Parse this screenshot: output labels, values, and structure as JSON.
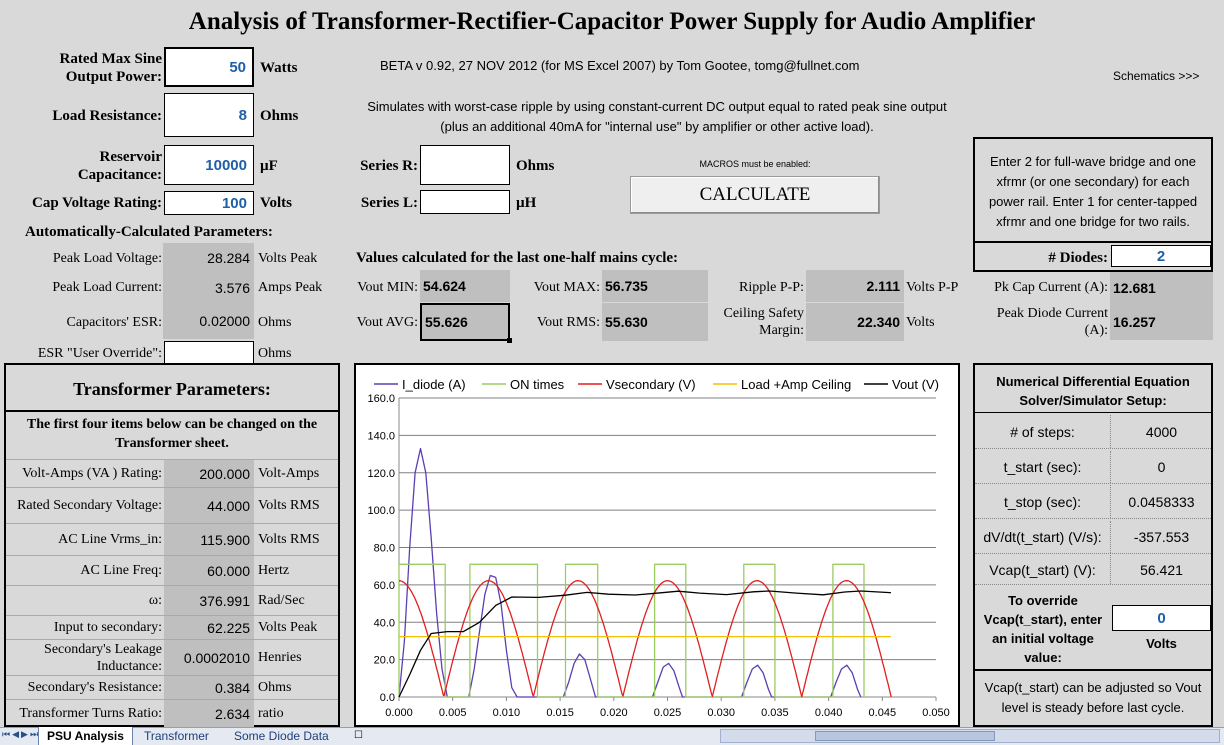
{
  "title": "Analysis of Transformer-Rectifier-Capacitor Power Supply for Audio Amplifier",
  "version_line": "BETA v 0.92, 27 NOV 2012 (for MS Excel 2007) by Tom Gootee, tomg@fullnet.com",
  "schematics_link": "Schematics >>>",
  "description_line1": "Simulates with worst-case ripple by using constant-current DC output equal to rated peak sine output",
  "description_line2": "(plus an additional 40mA for \"internal use\" by amplifier or other active load).",
  "inputs": {
    "rated_power_label": "Rated Max Sine Output Power:",
    "rated_power_value": "50",
    "rated_power_unit": "Watts",
    "load_res_label": "Load Resistance:",
    "load_res_value": "8",
    "load_res_unit": "Ohms",
    "reservoir_label": "Reservoir Capacitance:",
    "reservoir_value": "10000",
    "reservoir_unit": "µF",
    "cap_voltage_label": "Cap Voltage Rating:",
    "cap_voltage_value": "100",
    "cap_voltage_unit": "Volts",
    "series_r_label": "Series R:",
    "series_r_value": "",
    "series_r_unit": "Ohms",
    "series_l_label": "Series L:",
    "series_l_value": "",
    "series_l_unit": "µH"
  },
  "macros_note": "MACROS must be enabled:",
  "calculate_button": "CALCULATE",
  "diodes_panel": {
    "note": "Enter 2 for full-wave bridge and one xfrmr (or one secondary) for each power rail. Enter 1 for center-tapped xfrmr and one bridge for two rails.",
    "label": "# Diodes:",
    "value": "2"
  },
  "auto_params": {
    "heading": "Automatically-Calculated Parameters:",
    "peak_load_voltage_label": "Peak Load Voltage:",
    "peak_load_voltage_value": "28.284",
    "peak_load_voltage_unit": "Volts Peak",
    "peak_load_current_label": "Peak Load Current:",
    "peak_load_current_value": "3.576",
    "peak_load_current_unit": "Amps Peak",
    "esr_label": "Capacitors' ESR:",
    "esr_value": "0.02000",
    "esr_unit": "Ohms",
    "esr_override_label": "ESR \"User Override\":",
    "esr_override_value": "",
    "esr_override_unit": "Ohms"
  },
  "values": {
    "heading": "Values calculated for the last one-half mains cycle:",
    "vout_min_label": "Vout MIN:",
    "vout_min_value": "54.624",
    "vout_max_label": "Vout MAX:",
    "vout_max_value": "56.735",
    "ripple_label": "Ripple P-P:",
    "ripple_value": "2.111",
    "ripple_unit": "Volts P-P",
    "vout_avg_label": "Vout AVG:",
    "vout_avg_value": "55.626",
    "vout_rms_label": "Vout RMS:",
    "vout_rms_value": "55.630",
    "ceiling_label": "Ceiling Safety Margin:",
    "ceiling_value": "22.340",
    "ceiling_unit": "Volts",
    "pk_cap_label": "Pk Cap Current (A):",
    "pk_cap_value": "12.681",
    "peak_diode_label": "Peak Diode Current (A):",
    "peak_diode_value": "16.257"
  },
  "transformer": {
    "heading": "Transformer Parameters:",
    "subheading": "The first four items below can be changed  on the Transformer sheet.",
    "rows": [
      {
        "label": "Volt-Amps (VA ) Rating:",
        "value": "200.000",
        "unit": "Volt-Amps"
      },
      {
        "label": "Rated Secondary Voltage:",
        "value": "44.000",
        "unit": "Volts RMS"
      },
      {
        "label": "AC Line Vrms_in:",
        "value": "115.900",
        "unit": "Volts RMS"
      },
      {
        "label": "AC Line Freq:",
        "value": "60.000",
        "unit": "Hertz"
      },
      {
        "label": "ω:",
        "value": "376.991",
        "unit": "Rad/Sec"
      },
      {
        "label": "Input to secondary:",
        "value": "62.225",
        "unit": "Volts Peak"
      },
      {
        "label": "Secondary's Leakage Inductance:",
        "value": "0.0002010",
        "unit": "Henries"
      },
      {
        "label": "Secondary's Resistance:",
        "value": "0.384",
        "unit": "Ohms"
      },
      {
        "label": "Transformer Turns Ratio:",
        "value": "2.634",
        "unit": "ratio"
      }
    ]
  },
  "solver": {
    "heading": "Numerical Differential Equation Solver/Simulator Setup:",
    "rows": [
      {
        "label": "# of steps:",
        "value": "4000"
      },
      {
        "label": "t_start (sec):",
        "value": "0"
      },
      {
        "label": "t_stop (sec):",
        "value": "0.0458333"
      },
      {
        "label": "dV/dt(t_start) (V/s):",
        "value": "-357.553"
      },
      {
        "label": "Vcap(t_start) (V):",
        "value": "56.421"
      }
    ],
    "override_label": "To override Vcap(t_start), enter an initial voltage value:",
    "override_value": "0",
    "override_unit": "Volts",
    "footer_note": "Vcap(t_start) can be adjusted so Vout level is steady before last cycle."
  },
  "chart_data": {
    "type": "line",
    "title": "",
    "xlabel": "",
    "ylabel": "",
    "xlim": [
      0,
      0.05
    ],
    "ylim": [
      0,
      160
    ],
    "xticks": [
      "0.000",
      "0.005",
      "0.010",
      "0.015",
      "0.020",
      "0.025",
      "0.030",
      "0.035",
      "0.040",
      "0.045",
      "0.050"
    ],
    "yticks": [
      "0.0",
      "20.0",
      "40.0",
      "60.0",
      "80.0",
      "100.0",
      "120.0",
      "140.0",
      "160.0"
    ],
    "grid": "horizontal",
    "legend_position": "top",
    "series": [
      {
        "name": "I_diode (A)",
        "color": "#5b3fb3",
        "points": [
          [
            0.0,
            0
          ],
          [
            0.0005,
            30
          ],
          [
            0.001,
            80
          ],
          [
            0.0015,
            120
          ],
          [
            0.002,
            133
          ],
          [
            0.0025,
            120
          ],
          [
            0.003,
            85
          ],
          [
            0.0035,
            45
          ],
          [
            0.004,
            15
          ],
          [
            0.0045,
            0
          ],
          [
            0.0065,
            0
          ],
          [
            0.007,
            15
          ],
          [
            0.0075,
            35
          ],
          [
            0.008,
            55
          ],
          [
            0.0085,
            65
          ],
          [
            0.009,
            64
          ],
          [
            0.0095,
            50
          ],
          [
            0.01,
            25
          ],
          [
            0.0105,
            5
          ],
          [
            0.011,
            0
          ],
          [
            0.0153,
            0
          ],
          [
            0.0158,
            8
          ],
          [
            0.0163,
            18
          ],
          [
            0.0168,
            23
          ],
          [
            0.0173,
            20
          ],
          [
            0.0178,
            10
          ],
          [
            0.0183,
            0
          ],
          [
            0.0236,
            0
          ],
          [
            0.0241,
            8
          ],
          [
            0.0246,
            16
          ],
          [
            0.0251,
            18
          ],
          [
            0.0256,
            14
          ],
          [
            0.0261,
            5
          ],
          [
            0.0264,
            0
          ],
          [
            0.0319,
            0
          ],
          [
            0.0324,
            8
          ],
          [
            0.0329,
            15
          ],
          [
            0.0334,
            17
          ],
          [
            0.0339,
            13
          ],
          [
            0.0344,
            4
          ],
          [
            0.0347,
            0
          ],
          [
            0.0402,
            0
          ],
          [
            0.0407,
            8
          ],
          [
            0.0412,
            15
          ],
          [
            0.0417,
            17
          ],
          [
            0.0422,
            13
          ],
          [
            0.0427,
            4
          ],
          [
            0.043,
            0
          ]
        ]
      },
      {
        "name": "ON times",
        "color": "#9bcc62",
        "points": [
          [
            0.0,
            0
          ],
          [
            0.0,
            71
          ],
          [
            0.0043,
            71
          ],
          [
            0.0043,
            0
          ],
          [
            0.0066,
            0
          ],
          [
            0.0066,
            71
          ],
          [
            0.0129,
            71
          ],
          [
            0.0129,
            0
          ],
          [
            0.0155,
            0
          ],
          [
            0.0155,
            71
          ],
          [
            0.0185,
            71
          ],
          [
            0.0185,
            0
          ],
          [
            0.0238,
            0
          ],
          [
            0.0238,
            71
          ],
          [
            0.0267,
            71
          ],
          [
            0.0267,
            0
          ],
          [
            0.0321,
            0
          ],
          [
            0.0321,
            71
          ],
          [
            0.035,
            71
          ],
          [
            0.035,
            0
          ],
          [
            0.0404,
            0
          ],
          [
            0.0404,
            71
          ],
          [
            0.0433,
            71
          ],
          [
            0.0433,
            0
          ]
        ]
      },
      {
        "name": "Vsecondary (V)",
        "color": "#e21f1f",
        "waveform": "abs-sine",
        "amplitude": 62.225,
        "frequency_hz": 60,
        "x_end": 0.0458333
      },
      {
        "name": "Load +Amp Ceiling",
        "color": "#f2c100",
        "points": [
          [
            0.0,
            32.3
          ],
          [
            0.0458,
            32.3
          ]
        ]
      },
      {
        "name": "Vout (V)",
        "color": "#000000",
        "points": [
          [
            0.0,
            0
          ],
          [
            0.001,
            12
          ],
          [
            0.002,
            25
          ],
          [
            0.003,
            34
          ],
          [
            0.0045,
            35
          ],
          [
            0.006,
            35
          ],
          [
            0.0075,
            40
          ],
          [
            0.009,
            49
          ],
          [
            0.0105,
            53.5
          ],
          [
            0.013,
            53.3
          ],
          [
            0.0155,
            54.5
          ],
          [
            0.0175,
            56
          ],
          [
            0.0195,
            55
          ],
          [
            0.022,
            54.6
          ],
          [
            0.0245,
            55.8
          ],
          [
            0.026,
            56.6
          ],
          [
            0.028,
            55.6
          ],
          [
            0.0305,
            54.8
          ],
          [
            0.033,
            56.3
          ],
          [
            0.0345,
            56.7
          ],
          [
            0.037,
            55.6
          ],
          [
            0.0395,
            54.7
          ],
          [
            0.0415,
            56.2
          ],
          [
            0.043,
            56.7
          ],
          [
            0.0458,
            55.8
          ]
        ]
      }
    ]
  },
  "tabs": [
    "PSU Analysis",
    "Transformer",
    "Some Diode Data"
  ]
}
